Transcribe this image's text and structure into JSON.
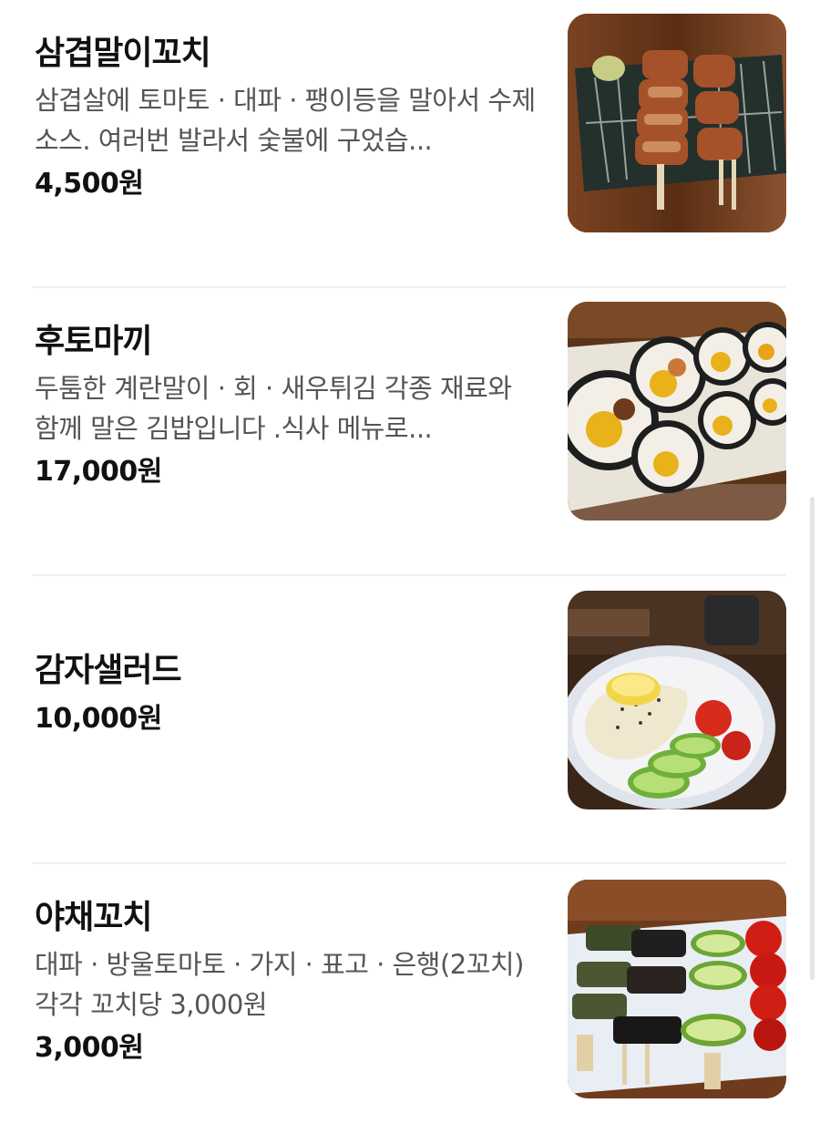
{
  "menu": {
    "items": [
      {
        "name": "삼겹말이꼬치",
        "description": "삼겹살에 토마토 · 대파 · 팽이등을 말아서 수제소스. 여러번 발라서 숯불에 구었습...",
        "price": "4,500원",
        "image_icon": "pork-belly-skewer-photo"
      },
      {
        "name": "후토마끼",
        "description": "두툼한 계란말이 · 회 · 새우튀김 각종 재료와 함께 말은 김밥입니다 .식사 메뉴로...",
        "price": "17,000원",
        "image_icon": "futomaki-roll-photo"
      },
      {
        "name": "감자샐러드",
        "description": "",
        "price": "10,000원",
        "image_icon": "potato-salad-photo"
      },
      {
        "name": "야채꼬치",
        "description": "대파 · 방울토마토 · 가지 · 표고 · 은행(2꼬치) 각각 꼬치당 3,000원",
        "price": "3,000원",
        "image_icon": "vegetable-skewer-photo"
      }
    ]
  }
}
